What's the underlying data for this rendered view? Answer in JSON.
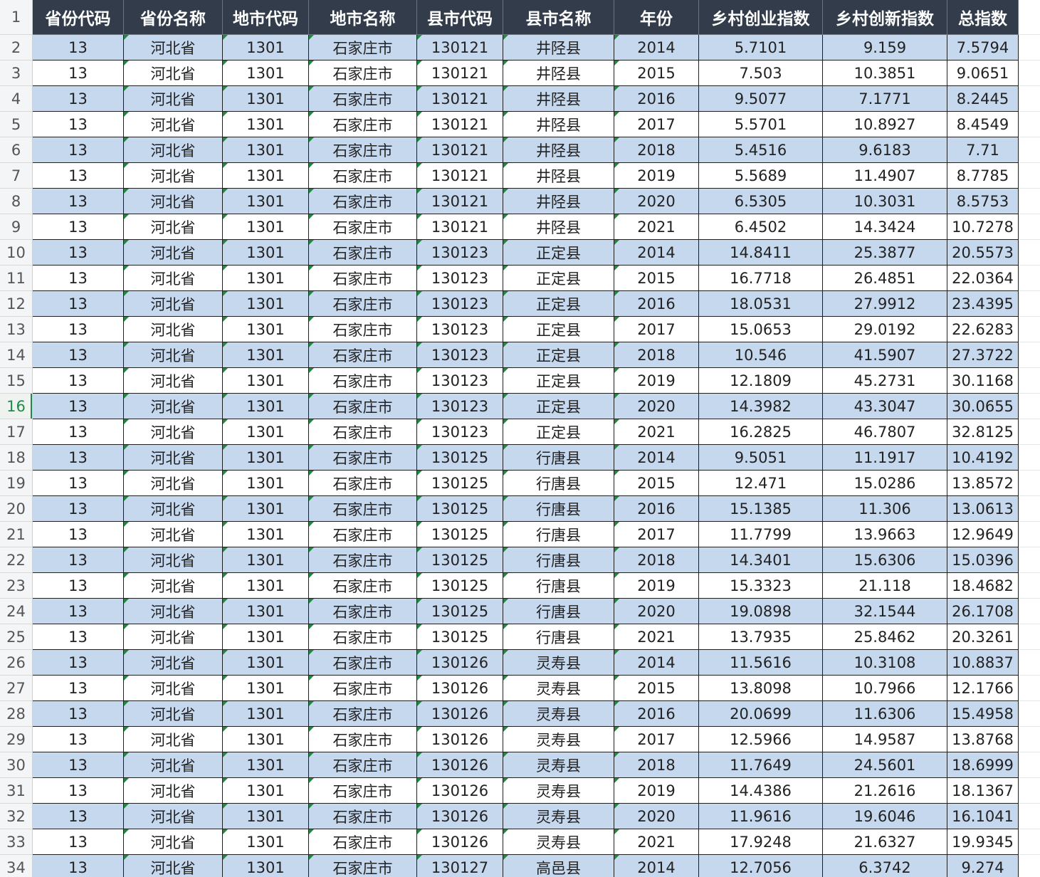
{
  "sheet": {
    "columns": [
      "省份代码",
      "省份名称",
      "地市代码",
      "地市名称",
      "县市代码",
      "县市名称",
      "年份",
      "乡村创业指数",
      "乡村创新指数",
      "总指数"
    ],
    "text_columns": [
      1,
      2,
      3,
      4,
      5,
      6
    ],
    "header_row_number": "1",
    "active_row": "16",
    "colors": {
      "header_bg": "#323c4a",
      "band_bg": "#c6d8ee",
      "marker": "#1e8a3c"
    },
    "rows": [
      {
        "n": "2",
        "cells": [
          "13",
          "河北省",
          "1301",
          "石家庄市",
          "130121",
          "井陉县",
          "2014",
          "5.7101",
          "9.159",
          "7.5794"
        ]
      },
      {
        "n": "3",
        "cells": [
          "13",
          "河北省",
          "1301",
          "石家庄市",
          "130121",
          "井陉县",
          "2015",
          "7.503",
          "10.3851",
          "9.0651"
        ]
      },
      {
        "n": "4",
        "cells": [
          "13",
          "河北省",
          "1301",
          "石家庄市",
          "130121",
          "井陉县",
          "2016",
          "9.5077",
          "7.1771",
          "8.2445"
        ]
      },
      {
        "n": "5",
        "cells": [
          "13",
          "河北省",
          "1301",
          "石家庄市",
          "130121",
          "井陉县",
          "2017",
          "5.5701",
          "10.8927",
          "8.4549"
        ]
      },
      {
        "n": "6",
        "cells": [
          "13",
          "河北省",
          "1301",
          "石家庄市",
          "130121",
          "井陉县",
          "2018",
          "5.4516",
          "9.6183",
          "7.71"
        ]
      },
      {
        "n": "7",
        "cells": [
          "13",
          "河北省",
          "1301",
          "石家庄市",
          "130121",
          "井陉县",
          "2019",
          "5.5689",
          "11.4907",
          "8.7785"
        ]
      },
      {
        "n": "8",
        "cells": [
          "13",
          "河北省",
          "1301",
          "石家庄市",
          "130121",
          "井陉县",
          "2020",
          "6.5305",
          "10.3031",
          "8.5753"
        ]
      },
      {
        "n": "9",
        "cells": [
          "13",
          "河北省",
          "1301",
          "石家庄市",
          "130121",
          "井陉县",
          "2021",
          "6.4502",
          "14.3424",
          "10.7278"
        ]
      },
      {
        "n": "10",
        "cells": [
          "13",
          "河北省",
          "1301",
          "石家庄市",
          "130123",
          "正定县",
          "2014",
          "14.8411",
          "25.3877",
          "20.5573"
        ]
      },
      {
        "n": "11",
        "cells": [
          "13",
          "河北省",
          "1301",
          "石家庄市",
          "130123",
          "正定县",
          "2015",
          "16.7718",
          "26.4851",
          "22.0364"
        ]
      },
      {
        "n": "12",
        "cells": [
          "13",
          "河北省",
          "1301",
          "石家庄市",
          "130123",
          "正定县",
          "2016",
          "18.0531",
          "27.9912",
          "23.4395"
        ]
      },
      {
        "n": "13",
        "cells": [
          "13",
          "河北省",
          "1301",
          "石家庄市",
          "130123",
          "正定县",
          "2017",
          "15.0653",
          "29.0192",
          "22.6283"
        ]
      },
      {
        "n": "14",
        "cells": [
          "13",
          "河北省",
          "1301",
          "石家庄市",
          "130123",
          "正定县",
          "2018",
          "10.546",
          "41.5907",
          "27.3722"
        ]
      },
      {
        "n": "15",
        "cells": [
          "13",
          "河北省",
          "1301",
          "石家庄市",
          "130123",
          "正定县",
          "2019",
          "12.1809",
          "45.2731",
          "30.1168"
        ]
      },
      {
        "n": "16",
        "cells": [
          "13",
          "河北省",
          "1301",
          "石家庄市",
          "130123",
          "正定县",
          "2020",
          "14.3982",
          "43.3047",
          "30.0655"
        ]
      },
      {
        "n": "17",
        "cells": [
          "13",
          "河北省",
          "1301",
          "石家庄市",
          "130123",
          "正定县",
          "2021",
          "16.2825",
          "46.7807",
          "32.8125"
        ]
      },
      {
        "n": "18",
        "cells": [
          "13",
          "河北省",
          "1301",
          "石家庄市",
          "130125",
          "行唐县",
          "2014",
          "9.5051",
          "11.1917",
          "10.4192"
        ]
      },
      {
        "n": "19",
        "cells": [
          "13",
          "河北省",
          "1301",
          "石家庄市",
          "130125",
          "行唐县",
          "2015",
          "12.471",
          "15.0286",
          "13.8572"
        ]
      },
      {
        "n": "20",
        "cells": [
          "13",
          "河北省",
          "1301",
          "石家庄市",
          "130125",
          "行唐县",
          "2016",
          "15.1385",
          "11.306",
          "13.0613"
        ]
      },
      {
        "n": "21",
        "cells": [
          "13",
          "河北省",
          "1301",
          "石家庄市",
          "130125",
          "行唐县",
          "2017",
          "11.7799",
          "13.9663",
          "12.9649"
        ]
      },
      {
        "n": "22",
        "cells": [
          "13",
          "河北省",
          "1301",
          "石家庄市",
          "130125",
          "行唐县",
          "2018",
          "14.3401",
          "15.6306",
          "15.0396"
        ]
      },
      {
        "n": "23",
        "cells": [
          "13",
          "河北省",
          "1301",
          "石家庄市",
          "130125",
          "行唐县",
          "2019",
          "15.3323",
          "21.118",
          "18.4682"
        ]
      },
      {
        "n": "24",
        "cells": [
          "13",
          "河北省",
          "1301",
          "石家庄市",
          "130125",
          "行唐县",
          "2020",
          "19.0898",
          "32.1544",
          "26.1708"
        ]
      },
      {
        "n": "25",
        "cells": [
          "13",
          "河北省",
          "1301",
          "石家庄市",
          "130125",
          "行唐县",
          "2021",
          "13.7935",
          "25.8462",
          "20.3261"
        ]
      },
      {
        "n": "26",
        "cells": [
          "13",
          "河北省",
          "1301",
          "石家庄市",
          "130126",
          "灵寿县",
          "2014",
          "11.5616",
          "10.3108",
          "10.8837"
        ]
      },
      {
        "n": "27",
        "cells": [
          "13",
          "河北省",
          "1301",
          "石家庄市",
          "130126",
          "灵寿县",
          "2015",
          "13.8098",
          "10.7966",
          "12.1766"
        ]
      },
      {
        "n": "28",
        "cells": [
          "13",
          "河北省",
          "1301",
          "石家庄市",
          "130126",
          "灵寿县",
          "2016",
          "20.0699",
          "11.6306",
          "15.4958"
        ]
      },
      {
        "n": "29",
        "cells": [
          "13",
          "河北省",
          "1301",
          "石家庄市",
          "130126",
          "灵寿县",
          "2017",
          "12.5966",
          "14.9587",
          "13.8768"
        ]
      },
      {
        "n": "30",
        "cells": [
          "13",
          "河北省",
          "1301",
          "石家庄市",
          "130126",
          "灵寿县",
          "2018",
          "11.7649",
          "24.5601",
          "18.6999"
        ]
      },
      {
        "n": "31",
        "cells": [
          "13",
          "河北省",
          "1301",
          "石家庄市",
          "130126",
          "灵寿县",
          "2019",
          "14.4386",
          "21.2616",
          "18.1367"
        ]
      },
      {
        "n": "32",
        "cells": [
          "13",
          "河北省",
          "1301",
          "石家庄市",
          "130126",
          "灵寿县",
          "2020",
          "11.9616",
          "19.6046",
          "16.1041"
        ]
      },
      {
        "n": "33",
        "cells": [
          "13",
          "河北省",
          "1301",
          "石家庄市",
          "130126",
          "灵寿县",
          "2021",
          "17.9248",
          "21.6327",
          "19.9345"
        ]
      },
      {
        "n": "34",
        "cells": [
          "13",
          "河北省",
          "1301",
          "石家庄市",
          "130127",
          "高邑县",
          "2014",
          "12.7056",
          "6.3742",
          "9.274"
        ]
      }
    ]
  }
}
